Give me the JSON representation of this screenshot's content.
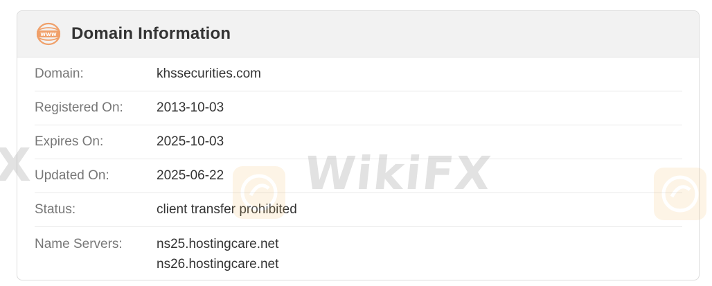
{
  "header": {
    "title": "Domain Information",
    "icon": "www-globe-icon",
    "accent_color": "#f0a06a"
  },
  "rows": [
    {
      "label": "Domain:",
      "value": "khssecurities.com"
    },
    {
      "label": "Registered On:",
      "value": "2013-10-03"
    },
    {
      "label": "Expires On:",
      "value": "2025-10-03"
    },
    {
      "label": "Updated On:",
      "value": "2025-06-22"
    },
    {
      "label": "Status:",
      "value": "client transfer prohibited"
    }
  ],
  "name_servers": {
    "label": "Name Servers:",
    "values": [
      "ns25.hostingcare.net",
      "ns26.hostingcare.net"
    ]
  },
  "watermark": {
    "text": "WikiFX",
    "edge_text": "X",
    "color": "#f5c26b"
  }
}
